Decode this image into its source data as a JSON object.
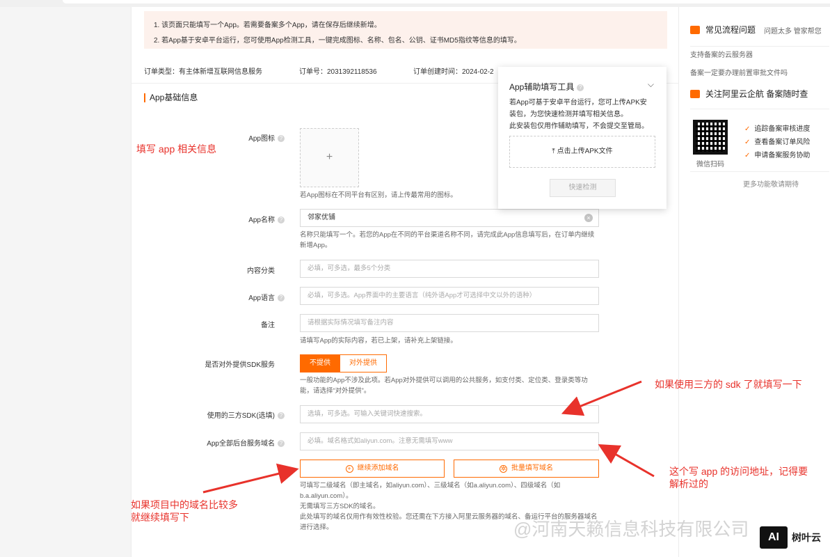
{
  "notice": {
    "line1": "1. 该页面只能填写一个App。若需要备案多个App，请在保存后继续新增。",
    "line2": "2. 若App基于安卓平台运行，您可使用App检测工具，一键完成图标、名称、包名、公钥、证书MD5指纹等信息的填写。"
  },
  "order": {
    "type": "订单类型：有主体新增互联网信息服务",
    "number": "订单号：2031392118536",
    "created": "订单创建时间：2024-02-2"
  },
  "section_title": "App基础信息",
  "form": {
    "icon_label": "App图标",
    "icon_plus": "+",
    "icon_help": "若App图标在不同平台有区别，请上传最常用的图标。",
    "name_label": "App名称",
    "name_value": "邻家优铺",
    "name_help": "名称只能填写一个。若您的App在不同的平台渠道名称不同，请完成此App信息填写后，在订单内继续新增App。",
    "category_label": "内容分类",
    "category_placeholder": "必填，可多选，最多5个分类",
    "language_label": "App语言",
    "language_placeholder": "必填，可多选。App界面中的主要语言（纯外语App才可选择中文以外的语种）",
    "remark_label": "备注",
    "remark_placeholder": "请根据实际情况填写备注内容",
    "remark_help": "请填写App的实际内容，若已上架，请补充上架链接。",
    "sdk_service_label": "是否对外提供SDK服务",
    "sdk_no": "不提供",
    "sdk_yes": "对外提供",
    "sdk_service_help": "一般功能的App不涉及此项。若App对外提供可以调用的公共服务，如支付类、定位类、登录类等功能，请选择“对外提供”。",
    "third_sdk_label": "使用的三方SDK(选填)",
    "third_sdk_placeholder": "选填，可多选。可输入关键词快速搜索。",
    "domain_label": "App全部后台服务域名",
    "domain_placeholder": "必填。域名格式如aliyun.com。注意无需填写www",
    "add_domain": "继续添加域名",
    "batch_domain": "批量填写域名",
    "domain_help1": "可填写二级域名（即主域名，如aliyun.com）、三级域名（如a.aliyun.com）、四级域名（如b.a.aliyun.com）。",
    "domain_help2": "无需填写三方SDK的域名。",
    "domain_help3": "此处填写的域名仅用作有效性校验。您还需在下方接入阿里云服务器的域名、备运行平台的服务器域名进行选择。"
  },
  "annotations": {
    "a1": "填写 app 相关信息",
    "a2": "如果使用三方的 sdk 了就填写一下",
    "a3_line1": "这个写 app 的访问地址，记得要",
    "a3_line2": "解析过的",
    "a4_line1": "如果项目中的域名比较多",
    "a4_line2": "就继续填写下"
  },
  "popover": {
    "title": "App辅助填写工具",
    "desc1": "若App可基于安卓平台运行，您可上传APK安",
    "desc2": "装包，为您快速检测并填写相关信息。",
    "desc3": "此安装包仅用作辅助填写，不会提交至管局。",
    "upload": "点击上传APK文件",
    "detect": "快速检测"
  },
  "right": {
    "faq_title": "常见流程问题",
    "faq_more": "问题太多 管家帮您",
    "link1": "支持备案的云服务器",
    "link2": "备案一定要办理前置审批文件吗",
    "follow_title": "关注阿里云企航 备案随时查",
    "qr_caption": "微信扫码",
    "check1": "追踪备案审核进度",
    "check2": "查看备案订单风险",
    "check3": "申请备案服务协助",
    "more": "更多功能敬请期待"
  },
  "watermark": "@河南天籁信息科技有限公司",
  "brand": {
    "logo": "AI",
    "name": "树叶云"
  },
  "colors": {
    "accent": "#ff6a00",
    "annotation": "#e8322b",
    "notice_bg": "#fdf1ec"
  }
}
